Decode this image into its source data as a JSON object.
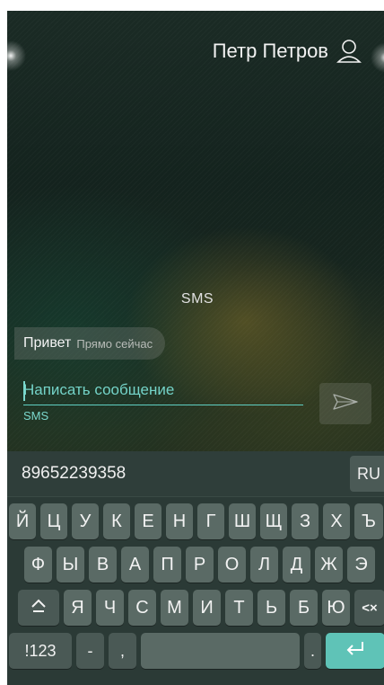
{
  "header": {
    "contact_name": "Петр Петров",
    "icon": "person-icon"
  },
  "conversation": {
    "mode_label": "SMS",
    "messages": [
      {
        "text": "Привет",
        "time": "Прямо сейчас"
      }
    ]
  },
  "composer": {
    "placeholder": "Написать сообщение",
    "channel_label": "SMS",
    "send_icon": "send-icon"
  },
  "keyboard": {
    "suggestion": "89652239358",
    "language_key": "RU",
    "rows": [
      [
        "Й",
        "Ц",
        "У",
        "К",
        "Е",
        "Н",
        "Г",
        "Ш",
        "Щ",
        "З",
        "Х",
        "Ъ"
      ],
      [
        "Ф",
        "Ы",
        "В",
        "А",
        "П",
        "Р",
        "О",
        "Л",
        "Д",
        "Ж",
        "Э"
      ],
      [
        "Я",
        "Ч",
        "С",
        "М",
        "И",
        "Т",
        "Ь",
        "Б",
        "Ю"
      ]
    ],
    "shift_icon": "shift-icon",
    "backspace_label": "<×",
    "symbols_label": "!123",
    "dash_label": "-",
    "comma_label": ",",
    "period_label": ".",
    "enter_icon": "enter-icon"
  },
  "colors": {
    "accent": "#5fc3b7",
    "key": "#5a6a65",
    "keyboard_bg": "#2b3a36"
  }
}
